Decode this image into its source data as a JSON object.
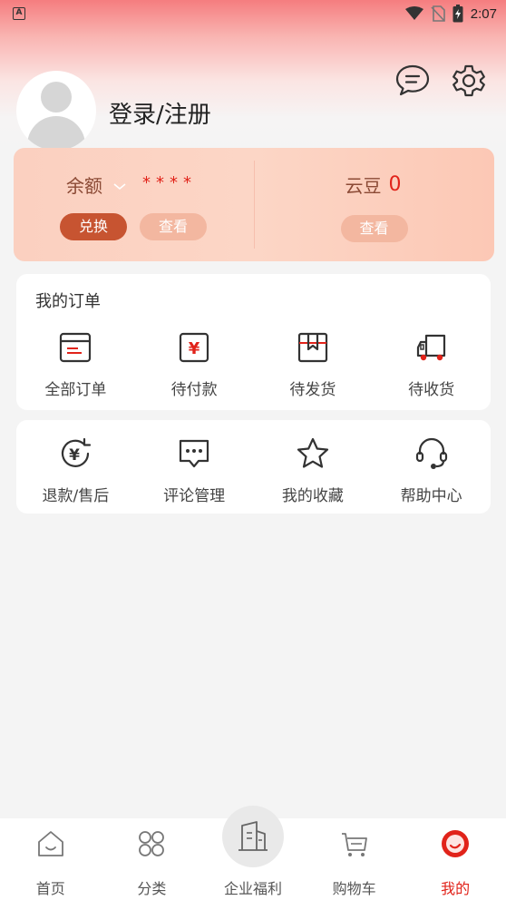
{
  "status_bar": {
    "left_icon": "A",
    "time": "2:07",
    "icons": [
      "wifi-icon",
      "no-sim-icon",
      "battery-charging-icon"
    ]
  },
  "profile": {
    "login_label": "登录/注册"
  },
  "header_icons": [
    "message-icon",
    "settings-gear-icon"
  ],
  "balance": {
    "label": "余额",
    "masked_value": "****",
    "exchange_button": "兑换",
    "view_button": "查看"
  },
  "yundou": {
    "label": "云豆",
    "value": "0",
    "view_button": "查看"
  },
  "orders": {
    "title": "我的订单",
    "items": [
      {
        "label": "全部订单",
        "icon": "all-orders-icon"
      },
      {
        "label": "待付款",
        "icon": "pending-payment-icon"
      },
      {
        "label": "待发货",
        "icon": "pending-shipment-icon"
      },
      {
        "label": "待收货",
        "icon": "pending-receipt-icon"
      }
    ]
  },
  "services": {
    "items": [
      {
        "label": "退款/售后",
        "icon": "refund-icon"
      },
      {
        "label": "评论管理",
        "icon": "comment-icon"
      },
      {
        "label": "我的收藏",
        "icon": "star-icon"
      },
      {
        "label": "帮助中心",
        "icon": "headset-icon"
      }
    ]
  },
  "tabbar": {
    "active_index": 4,
    "items": [
      {
        "label": "首页",
        "icon": "home-icon"
      },
      {
        "label": "分类",
        "icon": "category-icon"
      },
      {
        "label": "企业福利",
        "icon": "building-icon"
      },
      {
        "label": "购物车",
        "icon": "cart-icon"
      },
      {
        "label": "我的",
        "icon": "profile-icon"
      }
    ]
  },
  "colors": {
    "accent": "#e1231a",
    "exchange_button": "#c75431",
    "card_gradient": "#fcd6c6"
  }
}
